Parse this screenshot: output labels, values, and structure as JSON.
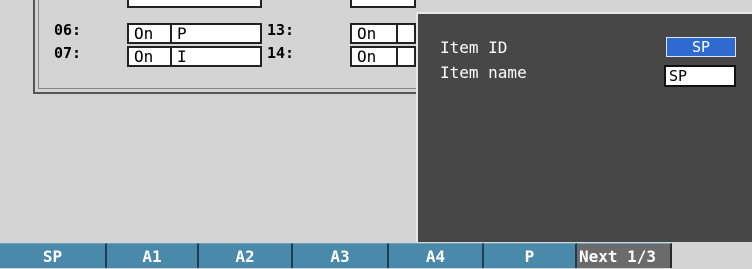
{
  "settings": {
    "rows": [
      {
        "no": "06:",
        "state": "On",
        "name": "P"
      },
      {
        "no": "07:",
        "state": "On",
        "name": "I"
      },
      {
        "no": "13:",
        "state": "On",
        "name": ""
      },
      {
        "no": "14:",
        "state": "On",
        "name": ""
      }
    ]
  },
  "dialog": {
    "item_id_label": "Item ID",
    "item_name_label": "Item name",
    "item_id_value": "SP",
    "item_name_value": "SP"
  },
  "softkeys": [
    "SP",
    "A1",
    "A2",
    "A3",
    "A4",
    "P",
    "Next 1/3"
  ],
  "colors": {
    "softkey": "#4a89a9",
    "dialog_bg": "#474747",
    "selected": "#2f6ad0"
  }
}
